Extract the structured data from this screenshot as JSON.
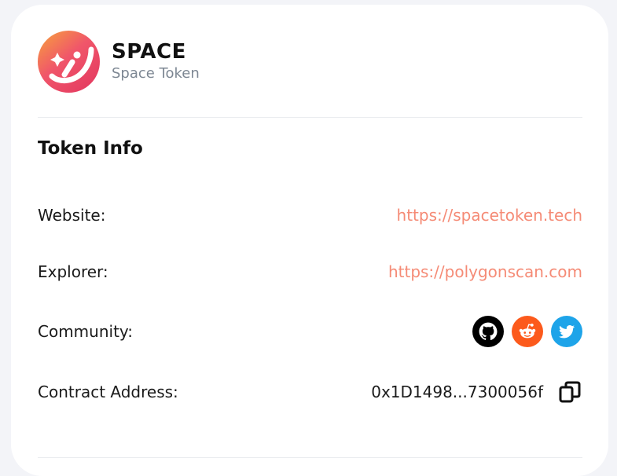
{
  "token": {
    "symbol": "SPACE",
    "name": "Space Token",
    "logo_icon": "space-token-logo"
  },
  "token_info": {
    "title": "Token Info",
    "website": {
      "label": "Website:",
      "value": "https://spacetoken.tech"
    },
    "explorer": {
      "label": "Explorer:",
      "value": "https://polygonscan.com"
    },
    "community": {
      "label": "Community:",
      "links": [
        {
          "icon": "github-icon",
          "color": "#000000"
        },
        {
          "icon": "reddit-icon",
          "color": "#fc5a1c"
        },
        {
          "icon": "twitter-icon",
          "color": "#1ea4e9"
        }
      ]
    },
    "contract": {
      "label": "Contract Address:",
      "value": "0x1D1498...7300056f",
      "copy_icon": "copy-icon"
    }
  },
  "colors": {
    "link": "#f58b76",
    "text": "#1a1a1a",
    "muted": "#7d8793"
  }
}
